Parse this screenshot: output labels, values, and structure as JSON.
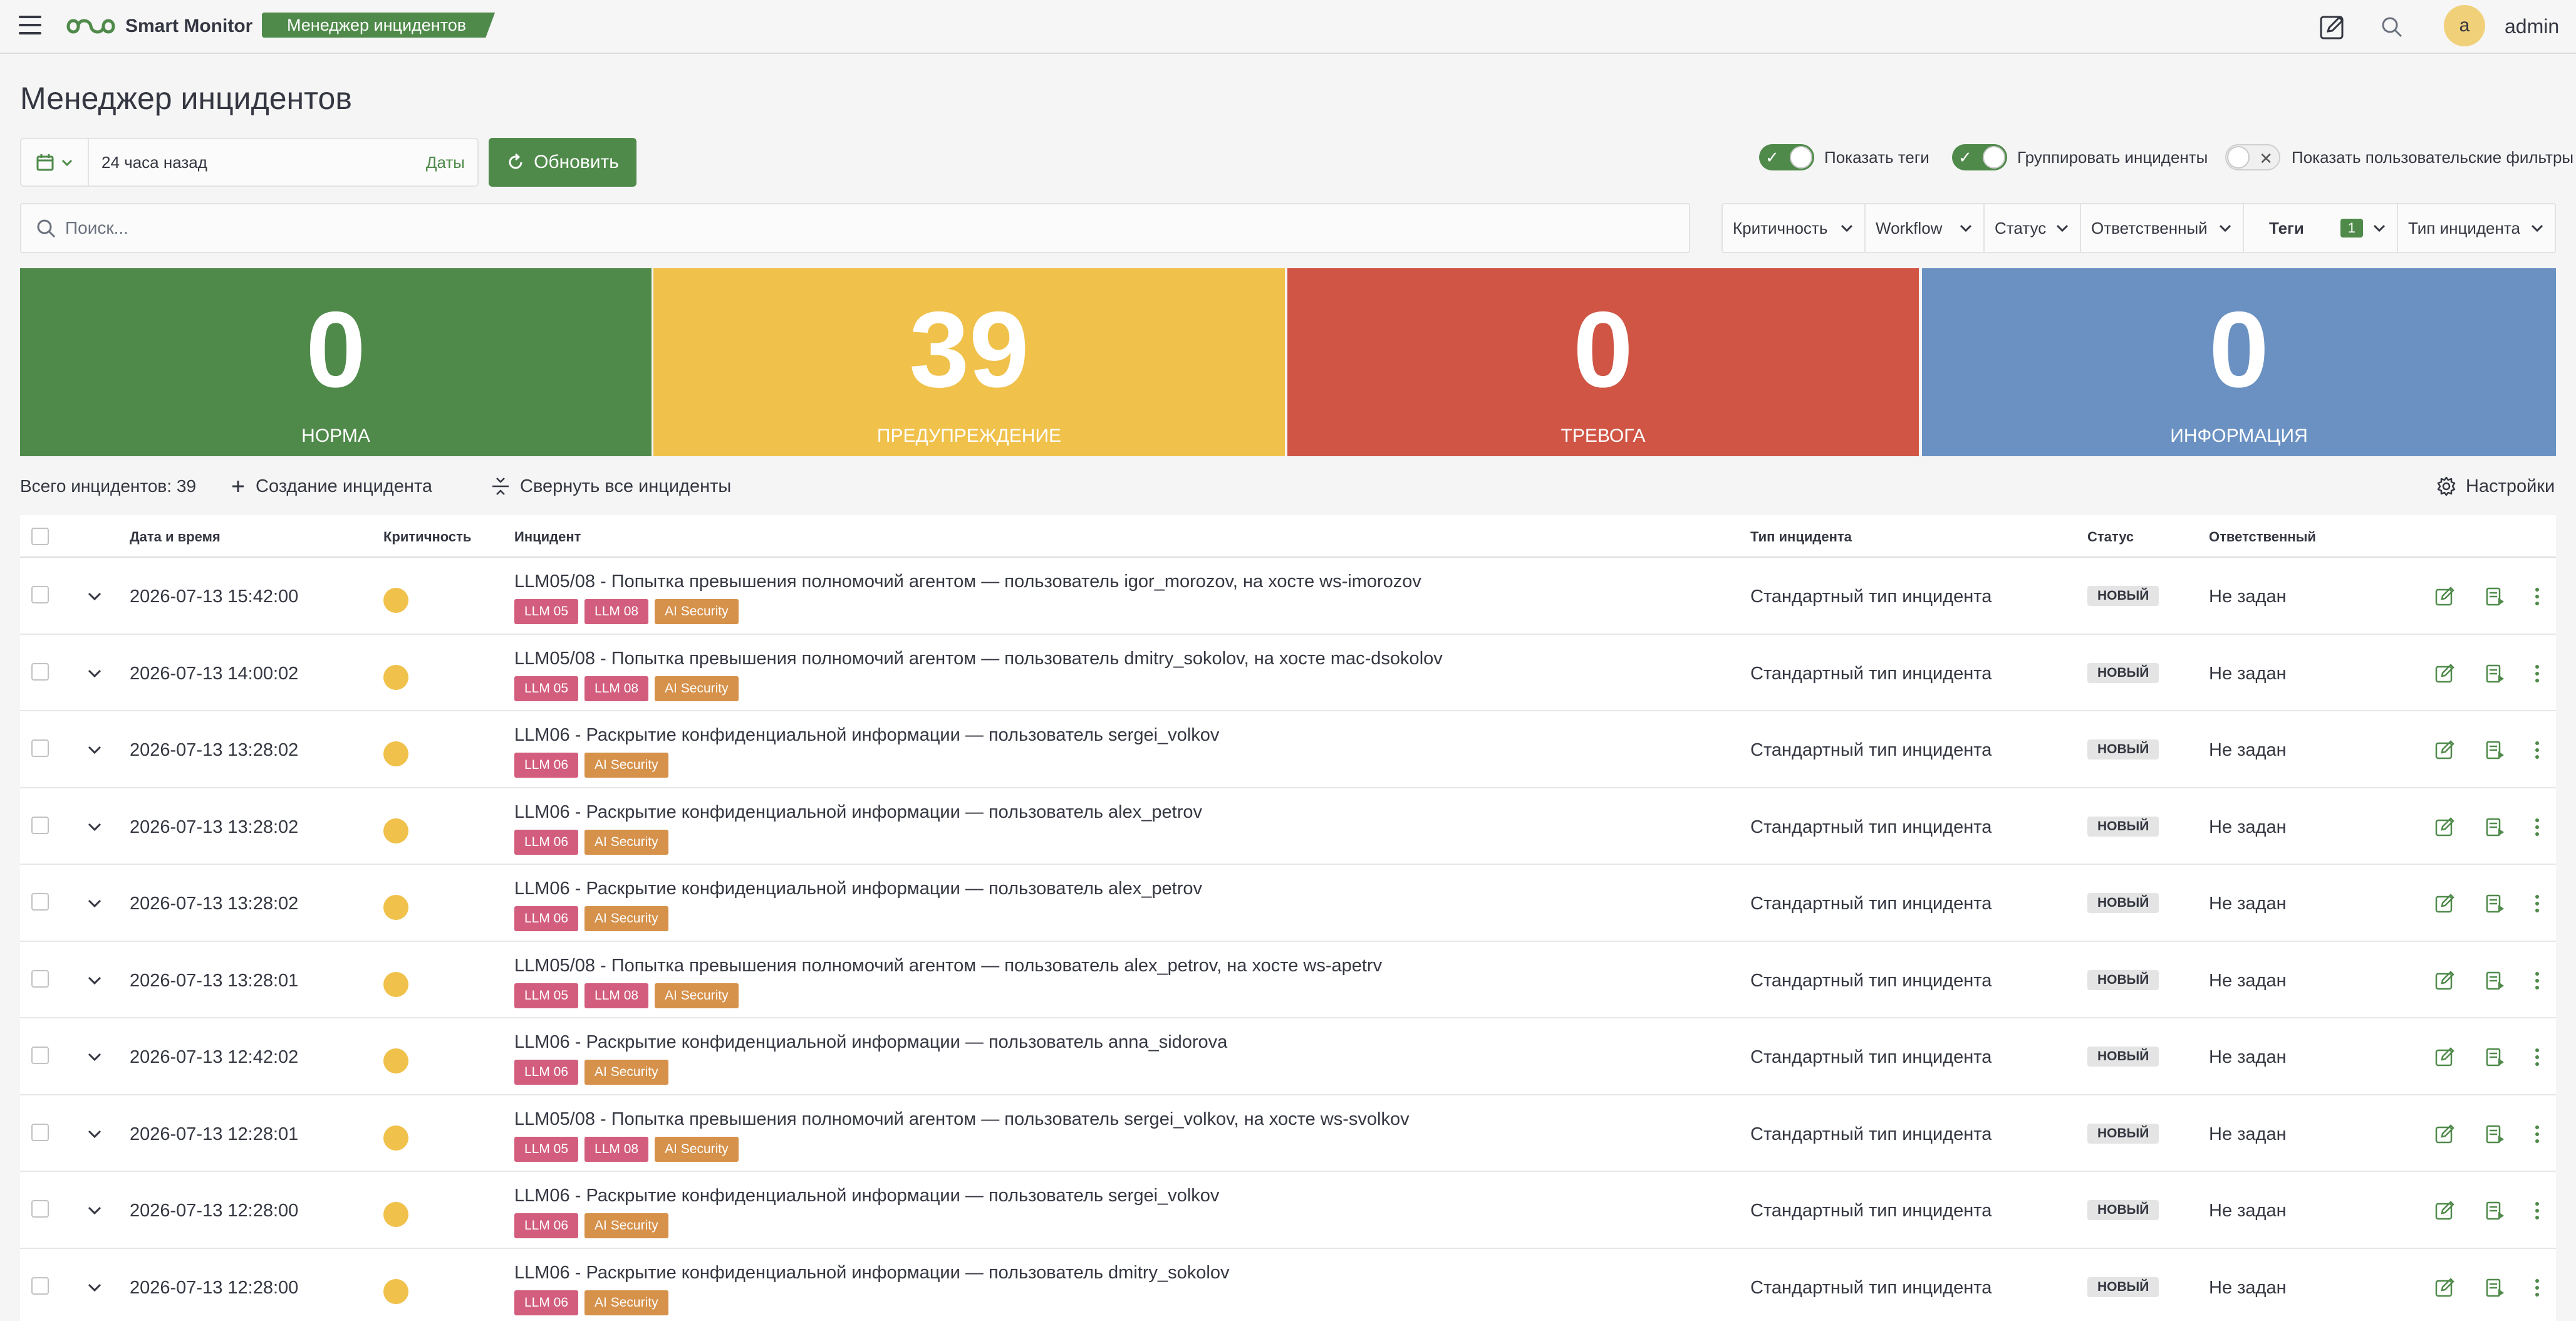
{
  "app": {
    "brand": "Smart Monitor",
    "breadcrumb": "Менеджер инцидентов"
  },
  "user": {
    "avatar_letter": "a",
    "name": "admin"
  },
  "page": {
    "title": "Менеджер инцидентов"
  },
  "date_picker": {
    "value": "24 часа назад",
    "dates_label": "Даты"
  },
  "refresh_label": "Обновить",
  "toggles": [
    {
      "label": "Показать теги",
      "on": true
    },
    {
      "label": "Группировать инциденты",
      "on": true
    },
    {
      "label": "Показать пользовательские фильтры",
      "on": false
    }
  ],
  "search": {
    "placeholder": "Поиск..."
  },
  "filters": [
    {
      "label": "Критичность"
    },
    {
      "label": "Workflow"
    },
    {
      "label": "Статус"
    },
    {
      "label": "Ответственный"
    },
    {
      "label": "Теги",
      "count": "1"
    },
    {
      "label": "Тип инцидента"
    }
  ],
  "stats": [
    {
      "value": "0",
      "label": "НОРМА",
      "color": "#4f8a4a"
    },
    {
      "value": "39",
      "label": "ПРЕДУПРЕЖДЕНИЕ",
      "color": "#f0c14b"
    },
    {
      "value": "0",
      "label": "ТРЕВОГА",
      "color": "#d05545"
    },
    {
      "value": "0",
      "label": "ИНФОРМАЦИЯ",
      "color": "#6a91c2"
    }
  ],
  "summary": {
    "total": "Всего инцидентов: 39",
    "create": "Создание инцидента",
    "collapse": "Свернуть все инциденты",
    "settings": "Настройки"
  },
  "table": {
    "columns": {
      "datetime": "Дата и время",
      "severity": "Критичность",
      "incident": "Инцидент",
      "type": "Тип инцидента",
      "status": "Статус",
      "owner": "Ответственный"
    },
    "rows": [
      {
        "datetime": "2026-07-13 15:42:00",
        "title": "LLM05/08 - Попытка превышения полномочий агентом — пользователь igor_morozov, на хосте ws-imorozov",
        "tags": [
          "LLM 05",
          "LLM 08",
          "AI Security"
        ],
        "type": "Стандартный тип инцидента",
        "status": "НОВЫЙ",
        "owner": "Не задан"
      },
      {
        "datetime": "2026-07-13 14:00:02",
        "title": "LLM05/08 - Попытка превышения полномочий агентом — пользователь dmitry_sokolov, на хосте mac-dsokolov",
        "tags": [
          "LLM 05",
          "LLM 08",
          "AI Security"
        ],
        "type": "Стандартный тип инцидента",
        "status": "НОВЫЙ",
        "owner": "Не задан"
      },
      {
        "datetime": "2026-07-13 13:28:02",
        "title": "LLM06 - Раскрытие конфиденциальной информации — пользователь sergei_volkov",
        "tags": [
          "LLM 06",
          "AI Security"
        ],
        "type": "Стандартный тип инцидента",
        "status": "НОВЫЙ",
        "owner": "Не задан"
      },
      {
        "datetime": "2026-07-13 13:28:02",
        "title": "LLM06 - Раскрытие конфиденциальной информации — пользователь alex_petrov",
        "tags": [
          "LLM 06",
          "AI Security"
        ],
        "type": "Стандартный тип инцидента",
        "status": "НОВЫЙ",
        "owner": "Не задан"
      },
      {
        "datetime": "2026-07-13 13:28:02",
        "title": "LLM06 - Раскрытие конфиденциальной информации — пользователь alex_petrov",
        "tags": [
          "LLM 06",
          "AI Security"
        ],
        "type": "Стандартный тип инцидента",
        "status": "НОВЫЙ",
        "owner": "Не задан"
      },
      {
        "datetime": "2026-07-13 13:28:01",
        "title": "LLM05/08 - Попытка превышения полномочий агентом — пользователь alex_petrov, на хосте ws-apetrv",
        "tags": [
          "LLM 05",
          "LLM 08",
          "AI Security"
        ],
        "type": "Стандартный тип инцидента",
        "status": "НОВЫЙ",
        "owner": "Не задан"
      },
      {
        "datetime": "2026-07-13 12:42:02",
        "title": "LLM06 - Раскрытие конфиденциальной информации — пользователь anna_sidorova",
        "tags": [
          "LLM 06",
          "AI Security"
        ],
        "type": "Стандартный тип инцидента",
        "status": "НОВЫЙ",
        "owner": "Не задан"
      },
      {
        "datetime": "2026-07-13 12:28:01",
        "title": "LLM05/08 - Попытка превышения полномочий агентом — пользователь sergei_volkov, на хосте ws-svolkov",
        "tags": [
          "LLM 05",
          "LLM 08",
          "AI Security"
        ],
        "type": "Стандартный тип инцидента",
        "status": "НОВЫЙ",
        "owner": "Не задан"
      },
      {
        "datetime": "2026-07-13 12:28:00",
        "title": "LLM06 - Раскрытие конфиденциальной информации — пользователь sergei_volkov",
        "tags": [
          "LLM 06",
          "AI Security"
        ],
        "type": "Стандартный тип инцидента",
        "status": "НОВЫЙ",
        "owner": "Не задан"
      },
      {
        "datetime": "2026-07-13 12:28:00",
        "title": "LLM06 - Раскрытие конфиденциальной информации — пользователь dmitry_sokolov",
        "tags": [
          "LLM 06",
          "AI Security"
        ],
        "type": "Стандартный тип инцидента",
        "status": "НОВЫЙ",
        "owner": "Не задан"
      }
    ]
  }
}
